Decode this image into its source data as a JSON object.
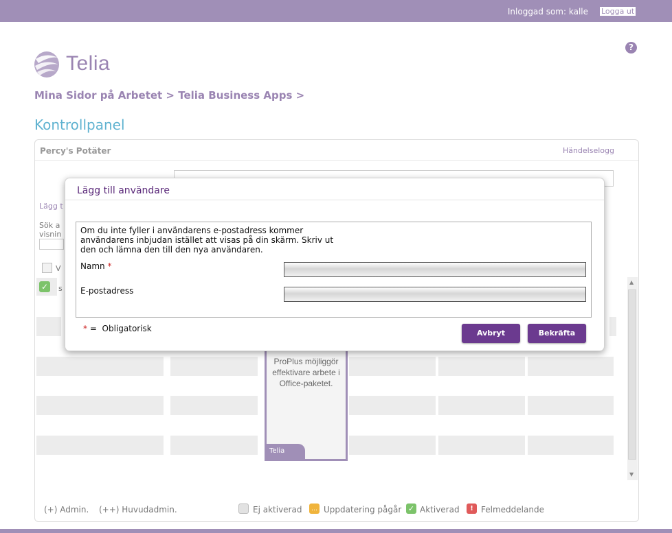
{
  "topbar": {
    "logged_in_text": "Inloggad som: kalle",
    "logout_label": "Logga ut"
  },
  "help": {
    "icon": "question-icon",
    "glyph": "?"
  },
  "logo": {
    "text": "Telia"
  },
  "breadcrumb": "Mina Sidor på Arbetet > Telia Business Apps >",
  "page_title": "Kontrollpanel",
  "panel": {
    "company": "Percy's Potäter",
    "event_log": "Händelselogg",
    "partial_add": "Lägg t",
    "partial_search": "Sök a",
    "partial_view": "visnin",
    "partial_v": "V",
    "partial_s": "s"
  },
  "card": {
    "text": "ProPlus möjliggör effektivare arbete i Office-paketet.",
    "brand": "Telia"
  },
  "legend": {
    "admin": "(+) Admin.",
    "head_admin": "(++) Huvudadmin.",
    "not_activated": "Ej aktiverad",
    "updating": "Uppdatering pågår",
    "activated": "Aktiverad",
    "error": "Felmeddelande"
  },
  "modal": {
    "title": "Lägg till användare",
    "info": "Om du inte fyller i användarens e-postadress kommer användarens inbjudan istället att visas på din skärm. Skriv ut den och lämna den till den nya användaren.",
    "name_label": "Namn",
    "required_mark": "*",
    "email_label": "E-postadress",
    "name_value": "",
    "email_value": "",
    "mandatory_mark": "*",
    "mandatory_eq": "=",
    "mandatory_text": "Obligatorisk",
    "cancel_label": "Avbryt",
    "confirm_label": "Bekräfta"
  },
  "colors": {
    "brand": "#a08fb7",
    "button": "#6b3a8f",
    "title": "#5fb2d0"
  }
}
